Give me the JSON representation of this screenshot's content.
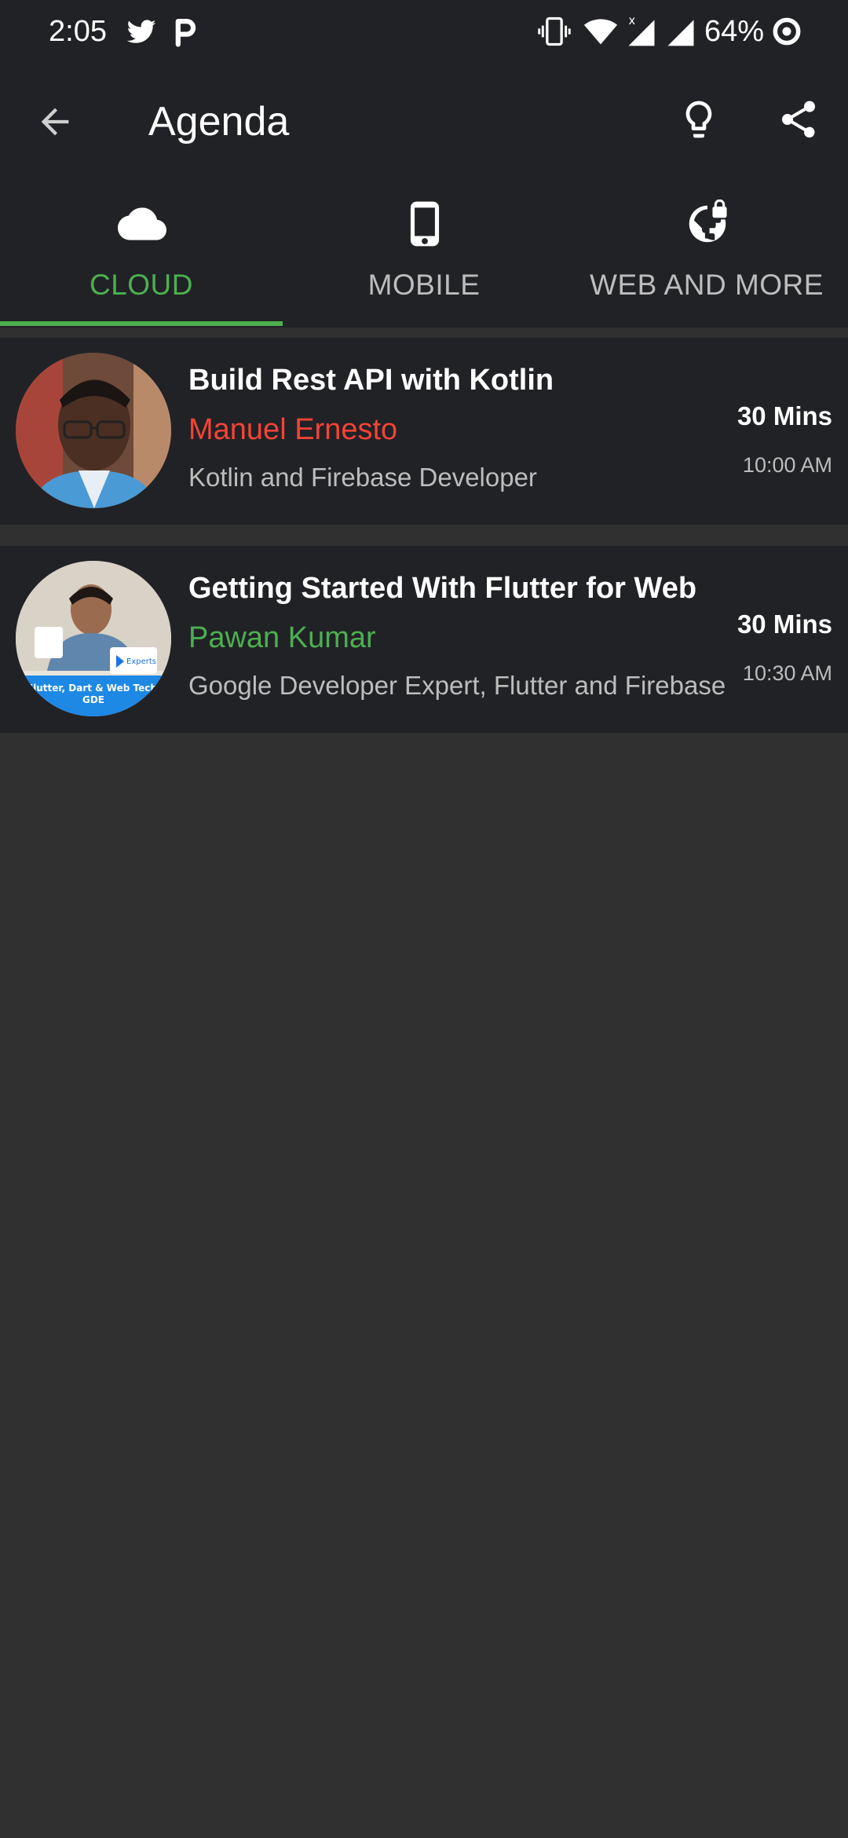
{
  "status_bar": {
    "time": "2:05",
    "battery": "64%",
    "icons": [
      "twitter-icon",
      "p-app-icon",
      "vibrate-icon",
      "wifi-icon",
      "signal-icon",
      "signal-icon",
      "battery-ring-icon"
    ]
  },
  "app_bar": {
    "title": "Agenda",
    "back_icon": "arrow-back-icon",
    "actions": [
      "lightbulb-icon",
      "share-icon"
    ]
  },
  "tabs": [
    {
      "label": "CLOUD",
      "icon": "cloud-icon",
      "active": true
    },
    {
      "label": "MOBILE",
      "icon": "phone-icon",
      "active": false
    },
    {
      "label": "WEB AND MORE",
      "icon": "globe-lock-icon",
      "active": false
    }
  ],
  "sessions": [
    {
      "title": "Build Rest API with Kotlin",
      "speaker": "Manuel Ernesto",
      "speaker_color": "#f44336",
      "description": "Kotlin and Firebase Developer",
      "duration": "30 Mins",
      "time": "10:00 AM"
    },
    {
      "title": "Getting Started With Flutter for Web",
      "speaker": "Pawan Kumar",
      "speaker_color": "#4caf50",
      "description": "Google Developer Expert, Flutter and Firebase",
      "duration": "30 Mins",
      "time": "10:30 AM",
      "avatar_caption": "Flutter, Dart & Web Tech GDE",
      "avatar_badge": "Experts"
    }
  ],
  "colors": {
    "accent": "#4caf50",
    "bar_background": "#212226",
    "page_background": "#303030"
  }
}
